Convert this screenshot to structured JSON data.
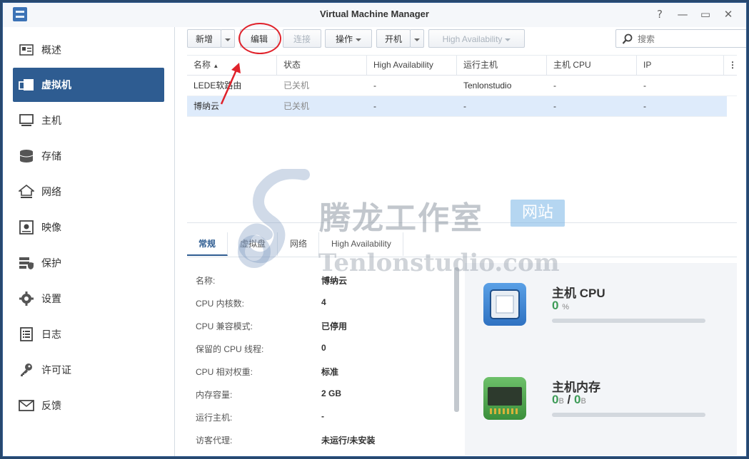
{
  "window": {
    "title": "Virtual Machine Manager",
    "controls": [
      "?",
      "—",
      "▭",
      "✕"
    ]
  },
  "sidebar": {
    "items": [
      {
        "label": "概述",
        "icon": "overview-icon"
      },
      {
        "label": "虚拟机",
        "icon": "virtual-machine-icon",
        "active": true
      },
      {
        "label": "主机",
        "icon": "host-icon"
      },
      {
        "label": "存储",
        "icon": "storage-icon"
      },
      {
        "label": "网络",
        "icon": "network-icon"
      },
      {
        "label": "映像",
        "icon": "image-icon"
      },
      {
        "label": "保护",
        "icon": "protection-icon"
      },
      {
        "label": "设置",
        "icon": "settings-icon"
      },
      {
        "label": "日志",
        "icon": "log-icon"
      },
      {
        "label": "许可证",
        "icon": "license-icon"
      },
      {
        "label": "反馈",
        "icon": "feedback-icon"
      }
    ]
  },
  "toolbar": {
    "new_label": "新增",
    "edit_label": "编辑",
    "connect_label": "连接",
    "action_label": "操作",
    "power_on_label": "开机",
    "ha_label": "High Availability",
    "search_placeholder": "搜索"
  },
  "table": {
    "columns": [
      "名称",
      "状态",
      "High Availability",
      "运行主机",
      "主机 CPU",
      "IP"
    ],
    "sort_indicator": "▲",
    "rows": [
      [
        "LEDE软路由",
        "已关机",
        "-",
        "Tenlonstudio",
        "-",
        "-"
      ],
      [
        "博纳云",
        "已关机",
        "-",
        "-",
        "-",
        "-"
      ]
    ]
  },
  "tabs": [
    "常规",
    "虚拟盘",
    "网络",
    "High Availability"
  ],
  "details": [
    {
      "key": "名称:",
      "value": "博纳云"
    },
    {
      "key": "CPU 内核数:",
      "value": "4"
    },
    {
      "key": "CPU 兼容模式:",
      "value": "已停用"
    },
    {
      "key": "保留的 CPU 线程:",
      "value": "0"
    },
    {
      "key": "CPU 相对权重:",
      "value": "标准"
    },
    {
      "key": "内存容量:",
      "value": "2 GB"
    },
    {
      "key": "运行主机:",
      "value": "-"
    },
    {
      "key": "访客代理:",
      "value": "未运行/未安装"
    }
  ],
  "resources": {
    "cpu": {
      "title": "主机 CPU",
      "value": "0",
      "unit": "%",
      "usage_fraction": 0
    },
    "memory": {
      "title": "主机内存",
      "used": "0",
      "used_unit": "B",
      "sep": "/",
      "total": "0",
      "total_unit": "B",
      "usage_fraction": 0
    }
  },
  "watermark": {
    "cn": "腾龙工作室",
    "tag": "网站",
    "en": "Tenlonstudio.com"
  },
  "colors": {
    "accent": "#2e5c91",
    "annotation": "#e0222b",
    "resource_green": "#3d9b57"
  }
}
